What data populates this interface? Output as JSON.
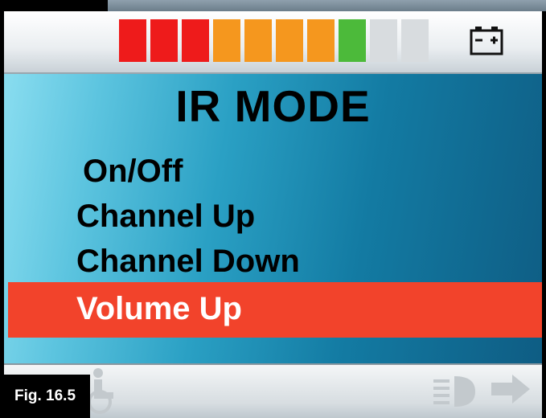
{
  "screen": {
    "title": "IR MODE",
    "menu_items": [
      {
        "label": "On/Off",
        "selected": false
      },
      {
        "label": "Channel Up",
        "selected": false
      },
      {
        "label": "Channel Down",
        "selected": false
      },
      {
        "label": "Volume Up",
        "selected": true
      }
    ]
  },
  "battery_gauge": {
    "segment_colors": [
      "#ee1b1b",
      "#ee1b1b",
      "#ee1b1b",
      "#f5971e",
      "#f5971e",
      "#f5971e",
      "#f5971e",
      "#4cba3a",
      "#d8dcdf",
      "#d8dcdf"
    ],
    "lit_segments": 8,
    "total_segments": 10
  },
  "colors": {
    "selection": "#f2432b",
    "screen_gradient_light": "#8fe0f2",
    "screen_gradient_dark": "#0e5b82"
  },
  "icons": {
    "battery": "battery-icon",
    "left_arrow": "arrow-left-icon",
    "wheelchair": "wheelchair-icon",
    "headlight": "headlight-icon",
    "right_arrow": "arrow-right-icon"
  },
  "figure_label": "Fig. 16.5"
}
